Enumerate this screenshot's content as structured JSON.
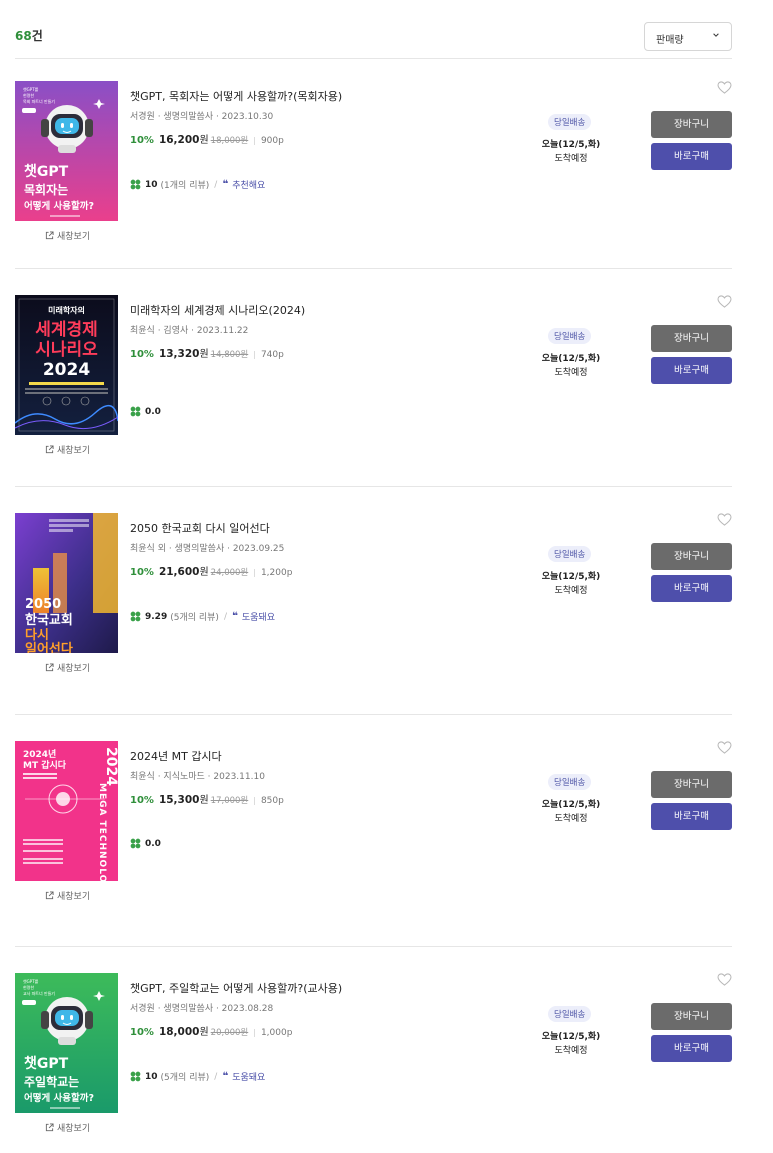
{
  "header": {
    "count_number": "68",
    "count_suffix": "건",
    "sort_value": "판매량"
  },
  "colors": {
    "accent_green": "#2f8f3a",
    "accent_purple": "#4e4fab",
    "cart_gray": "#6b6b6b"
  },
  "common": {
    "new_window": "새창보기",
    "cart_label": "장바구니",
    "buy_label": "바로구매",
    "badge": "당일배송",
    "delivery_date": "오늘(12/5,화)",
    "delivery_note": "도착예정",
    "won": "원"
  },
  "items": [
    {
      "title": "챗GPT, 목회자는 어떻게 사용할까?(목회자용)",
      "meta": "서경원 · 생명의말씀사 · 2023.10.30",
      "discount": "10%",
      "sale_price": "16,200",
      "original_price": "18,000원",
      "pages": "900p",
      "score": "10",
      "reviews": "(1개의 리뷰)",
      "tag": "추천해요",
      "cover": {
        "title_lines": [
          "챗GPT",
          "목회자는",
          "어떻게 사용할까?"
        ],
        "top_text": [
          "챗GPT를",
          "현명한",
          "목회 파트너 만들기"
        ]
      }
    },
    {
      "title": "미래학자의 세계경제 시나리오(2024)",
      "meta": "최윤식 · 김영사 · 2023.11.22",
      "discount": "10%",
      "sale_price": "13,320",
      "original_price": "14,800원",
      "pages": "740p",
      "score": "0.0",
      "reviews": "",
      "tag": "",
      "cover": {
        "title_lines": [
          "미래학자의",
          "세계경제",
          "시나리오",
          "2024"
        ]
      }
    },
    {
      "title": "2050 한국교회 다시 일어선다",
      "meta": "최윤식 외 · 생명의말씀사 · 2023.09.25",
      "discount": "10%",
      "sale_price": "21,600",
      "original_price": "24,000원",
      "pages": "1,200p",
      "score": "9.29",
      "reviews": "(5개의 리뷰)",
      "tag": "도움돼요",
      "cover": {
        "title_lines": [
          "2050",
          "한국교회",
          "다시",
          "일어선다"
        ]
      }
    },
    {
      "title": "2024년 MT 갑시다",
      "meta": "최윤식 · 지식노마드 · 2023.11.10",
      "discount": "10%",
      "sale_price": "15,300",
      "original_price": "17,000원",
      "pages": "850p",
      "score": "0.0",
      "reviews": "",
      "tag": "",
      "cover": {
        "title_lines": [
          "2024년",
          "MT 갑시다"
        ],
        "side": "2024",
        "vertical": "MEGA TECHNOLOGY"
      }
    },
    {
      "title": "챗GPT, 주일학교는 어떻게 사용할까?(교사용)",
      "meta": "서경원 · 생명의말씀사 · 2023.08.28",
      "discount": "10%",
      "sale_price": "18,000",
      "original_price": "20,000원",
      "pages": "1,000p",
      "score": "10",
      "reviews": "(5개의 리뷰)",
      "tag": "도움돼요",
      "cover": {
        "title_lines": [
          "챗GPT",
          "주일학교는",
          "어떻게 사용할까?"
        ],
        "top_text": [
          "챗GPT를",
          "현명한",
          "교사 파트너 만들기"
        ]
      }
    }
  ]
}
